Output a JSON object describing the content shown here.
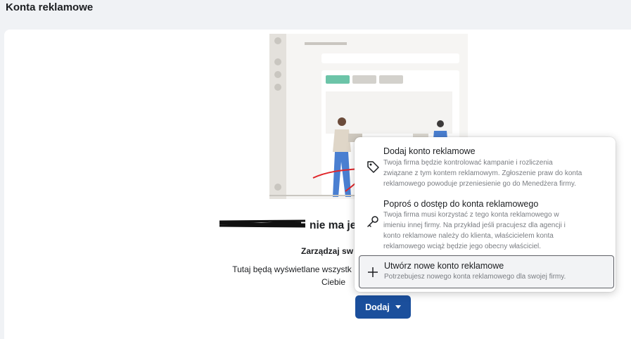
{
  "page": {
    "title": "Konta reklamowe"
  },
  "empty_state": {
    "title_suffix": "nie ma je",
    "subtitle": "Zarządzaj sw",
    "description_lines": [
      "Tutaj będą wyświetlane wszystk",
      "Ciebie"
    ]
  },
  "add_button": {
    "label": "Dodaj",
    "color": "#1b4f9c"
  },
  "menu": {
    "items": [
      {
        "title": "Dodaj konto reklamowe",
        "icon": "tag-icon",
        "description_lines": [
          "Twoja firma będzie kontrolować kampanie i rozliczenia",
          "związane z tym kontem reklamowym. Zgłoszenie praw do konta",
          "reklamowego powoduje przeniesienie go do Menedżera firmy."
        ]
      },
      {
        "title": "Poproś o dostęp do konta reklamowego",
        "icon": "key-icon",
        "description_lines": [
          "Twoja firma musi korzystać z tego konta reklamowego w",
          "imieniu innej firmy. Na przykład jeśli pracujesz dla agencji i",
          "konto reklamowe należy do klienta, właścicielem konta",
          "reklamowego wciąż będzie jego obecny właściciel."
        ]
      },
      {
        "title": "Utwórz nowe konto reklamowe",
        "icon": "plus-icon",
        "description_lines": [
          "Potrzebujesz nowego konta reklamowego dla swojej firmy."
        ]
      }
    ]
  }
}
